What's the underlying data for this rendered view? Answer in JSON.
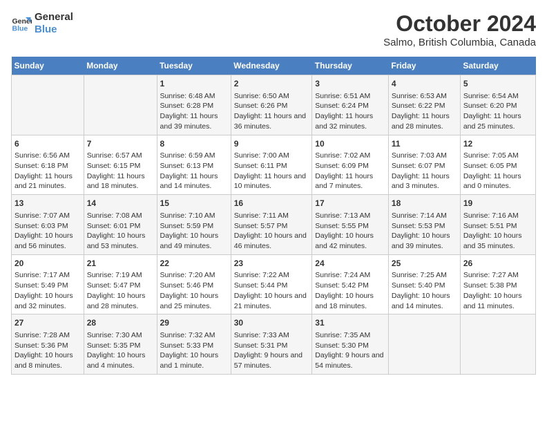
{
  "header": {
    "logo_line1": "General",
    "logo_line2": "Blue",
    "title": "October 2024",
    "subtitle": "Salmo, British Columbia, Canada"
  },
  "days_of_week": [
    "Sunday",
    "Monday",
    "Tuesday",
    "Wednesday",
    "Thursday",
    "Friday",
    "Saturday"
  ],
  "weeks": [
    [
      {
        "day": "",
        "info": ""
      },
      {
        "day": "",
        "info": ""
      },
      {
        "day": "1",
        "info": "Sunrise: 6:48 AM\nSunset: 6:28 PM\nDaylight: 11 hours and 39 minutes."
      },
      {
        "day": "2",
        "info": "Sunrise: 6:50 AM\nSunset: 6:26 PM\nDaylight: 11 hours and 36 minutes."
      },
      {
        "day": "3",
        "info": "Sunrise: 6:51 AM\nSunset: 6:24 PM\nDaylight: 11 hours and 32 minutes."
      },
      {
        "day": "4",
        "info": "Sunrise: 6:53 AM\nSunset: 6:22 PM\nDaylight: 11 hours and 28 minutes."
      },
      {
        "day": "5",
        "info": "Sunrise: 6:54 AM\nSunset: 6:20 PM\nDaylight: 11 hours and 25 minutes."
      }
    ],
    [
      {
        "day": "6",
        "info": "Sunrise: 6:56 AM\nSunset: 6:18 PM\nDaylight: 11 hours and 21 minutes."
      },
      {
        "day": "7",
        "info": "Sunrise: 6:57 AM\nSunset: 6:15 PM\nDaylight: 11 hours and 18 minutes."
      },
      {
        "day": "8",
        "info": "Sunrise: 6:59 AM\nSunset: 6:13 PM\nDaylight: 11 hours and 14 minutes."
      },
      {
        "day": "9",
        "info": "Sunrise: 7:00 AM\nSunset: 6:11 PM\nDaylight: 11 hours and 10 minutes."
      },
      {
        "day": "10",
        "info": "Sunrise: 7:02 AM\nSunset: 6:09 PM\nDaylight: 11 hours and 7 minutes."
      },
      {
        "day": "11",
        "info": "Sunrise: 7:03 AM\nSunset: 6:07 PM\nDaylight: 11 hours and 3 minutes."
      },
      {
        "day": "12",
        "info": "Sunrise: 7:05 AM\nSunset: 6:05 PM\nDaylight: 11 hours and 0 minutes."
      }
    ],
    [
      {
        "day": "13",
        "info": "Sunrise: 7:07 AM\nSunset: 6:03 PM\nDaylight: 10 hours and 56 minutes."
      },
      {
        "day": "14",
        "info": "Sunrise: 7:08 AM\nSunset: 6:01 PM\nDaylight: 10 hours and 53 minutes."
      },
      {
        "day": "15",
        "info": "Sunrise: 7:10 AM\nSunset: 5:59 PM\nDaylight: 10 hours and 49 minutes."
      },
      {
        "day": "16",
        "info": "Sunrise: 7:11 AM\nSunset: 5:57 PM\nDaylight: 10 hours and 46 minutes."
      },
      {
        "day": "17",
        "info": "Sunrise: 7:13 AM\nSunset: 5:55 PM\nDaylight: 10 hours and 42 minutes."
      },
      {
        "day": "18",
        "info": "Sunrise: 7:14 AM\nSunset: 5:53 PM\nDaylight: 10 hours and 39 minutes."
      },
      {
        "day": "19",
        "info": "Sunrise: 7:16 AM\nSunset: 5:51 PM\nDaylight: 10 hours and 35 minutes."
      }
    ],
    [
      {
        "day": "20",
        "info": "Sunrise: 7:17 AM\nSunset: 5:49 PM\nDaylight: 10 hours and 32 minutes."
      },
      {
        "day": "21",
        "info": "Sunrise: 7:19 AM\nSunset: 5:47 PM\nDaylight: 10 hours and 28 minutes."
      },
      {
        "day": "22",
        "info": "Sunrise: 7:20 AM\nSunset: 5:46 PM\nDaylight: 10 hours and 25 minutes."
      },
      {
        "day": "23",
        "info": "Sunrise: 7:22 AM\nSunset: 5:44 PM\nDaylight: 10 hours and 21 minutes."
      },
      {
        "day": "24",
        "info": "Sunrise: 7:24 AM\nSunset: 5:42 PM\nDaylight: 10 hours and 18 minutes."
      },
      {
        "day": "25",
        "info": "Sunrise: 7:25 AM\nSunset: 5:40 PM\nDaylight: 10 hours and 14 minutes."
      },
      {
        "day": "26",
        "info": "Sunrise: 7:27 AM\nSunset: 5:38 PM\nDaylight: 10 hours and 11 minutes."
      }
    ],
    [
      {
        "day": "27",
        "info": "Sunrise: 7:28 AM\nSunset: 5:36 PM\nDaylight: 10 hours and 8 minutes."
      },
      {
        "day": "28",
        "info": "Sunrise: 7:30 AM\nSunset: 5:35 PM\nDaylight: 10 hours and 4 minutes."
      },
      {
        "day": "29",
        "info": "Sunrise: 7:32 AM\nSunset: 5:33 PM\nDaylight: 10 hours and 1 minute."
      },
      {
        "day": "30",
        "info": "Sunrise: 7:33 AM\nSunset: 5:31 PM\nDaylight: 9 hours and 57 minutes."
      },
      {
        "day": "31",
        "info": "Sunrise: 7:35 AM\nSunset: 5:30 PM\nDaylight: 9 hours and 54 minutes."
      },
      {
        "day": "",
        "info": ""
      },
      {
        "day": "",
        "info": ""
      }
    ]
  ]
}
